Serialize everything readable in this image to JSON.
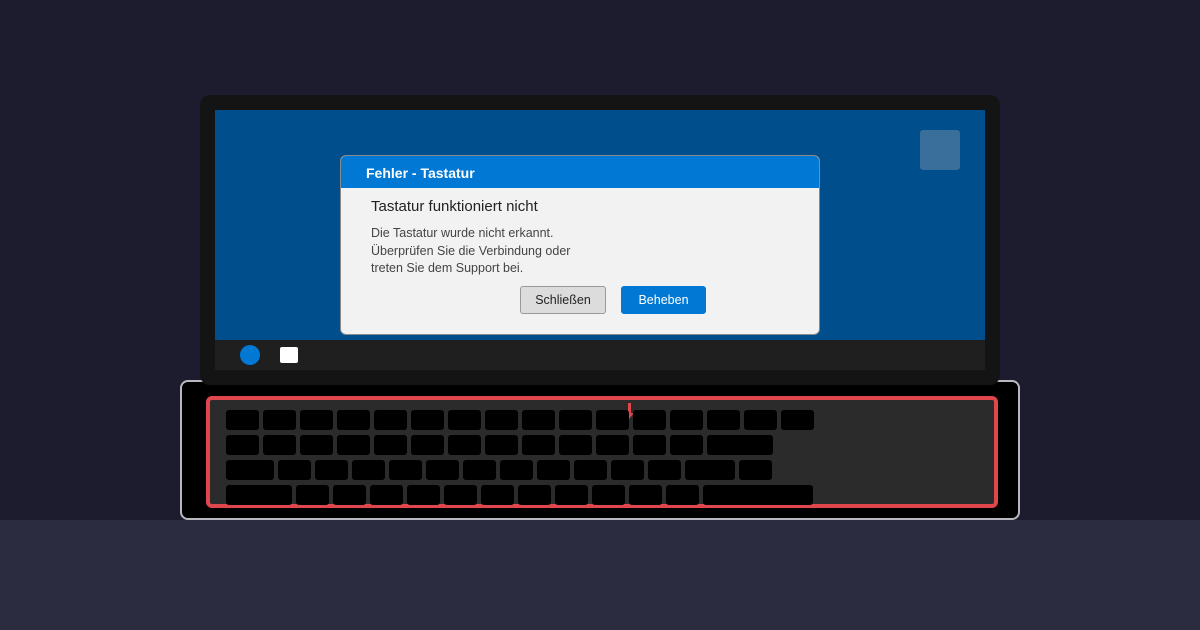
{
  "dialog": {
    "title": "Fehler - Tastatur",
    "heading": "Tastatur funktioniert nicht",
    "message_lines": [
      "Die Tastatur wurde nicht erkannt.",
      "Überprüfen Sie die Verbindung oder",
      "treten Sie dem Support bei."
    ],
    "close_label": "Schließen",
    "fix_label": "Beheben"
  },
  "colors": {
    "desktop": "#004e8c",
    "accent": "#0078d4",
    "highlight": "#e0474c",
    "taskbar": "#1f1f1f"
  },
  "icons": {
    "start": "start-button-circle",
    "task": "app-window-icon",
    "desktop": "desktop-shortcut-icon",
    "pointer": "arrow-down-icon"
  }
}
